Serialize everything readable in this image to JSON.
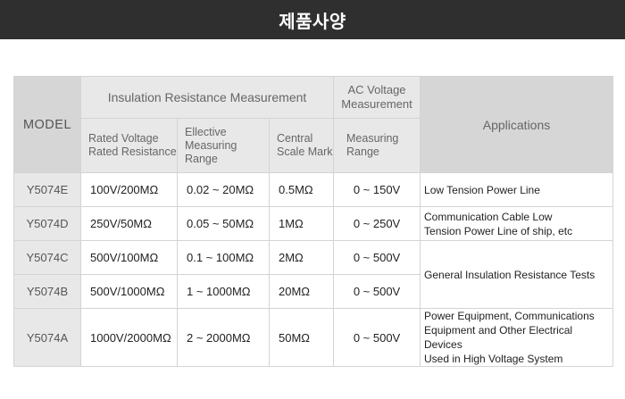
{
  "header": {
    "title": "제품사양"
  },
  "table": {
    "model_label": "MODEL",
    "group_ir": "Insulation Resistance Measurement",
    "group_ac": "AC Voltage Measurement",
    "applications_label": "Applications",
    "sub_headers": {
      "rated": [
        "Rated Voltage",
        "Rated Resistance"
      ],
      "effective": [
        "Ellective",
        "Measuring Range"
      ],
      "central": [
        "Central",
        "Scale Mark"
      ],
      "measuring": [
        "Measuring",
        "Range"
      ]
    },
    "rows": [
      {
        "model": "Y5074E",
        "rated": "100V/200MΩ",
        "effective": "0.02 ~ 20MΩ",
        "central": "0.5MΩ",
        "ac": "0 ~ 150V"
      },
      {
        "model": "Y5074D",
        "rated": "250V/50MΩ",
        "effective": "0.05 ~ 50MΩ",
        "central": "1MΩ",
        "ac": "0 ~ 250V"
      },
      {
        "model": "Y5074C",
        "rated": "500V/100MΩ",
        "effective": "0.1 ~ 100MΩ",
        "central": "2MΩ",
        "ac": "0 ~ 500V"
      },
      {
        "model": "Y5074B",
        "rated": "500V/1000MΩ",
        "effective": "1 ~ 1000MΩ",
        "central": "20MΩ",
        "ac": "0 ~ 500V"
      },
      {
        "model": "Y5074A",
        "rated": "1000V/2000MΩ",
        "effective": "2 ~ 2000MΩ",
        "central": "50MΩ",
        "ac": "0 ~ 500V"
      }
    ],
    "applications": {
      "e": [
        "Low Tension Power Line"
      ],
      "d": [
        "Communication Cable Low",
        "Tension Power Line of ship, etc"
      ],
      "cb": [
        "General Insulation Resistance Tests"
      ],
      "a": [
        "Power Equipment, Communications",
        "Equipment and Other Electrical Devices",
        "Used in High Voltage System"
      ]
    }
  }
}
